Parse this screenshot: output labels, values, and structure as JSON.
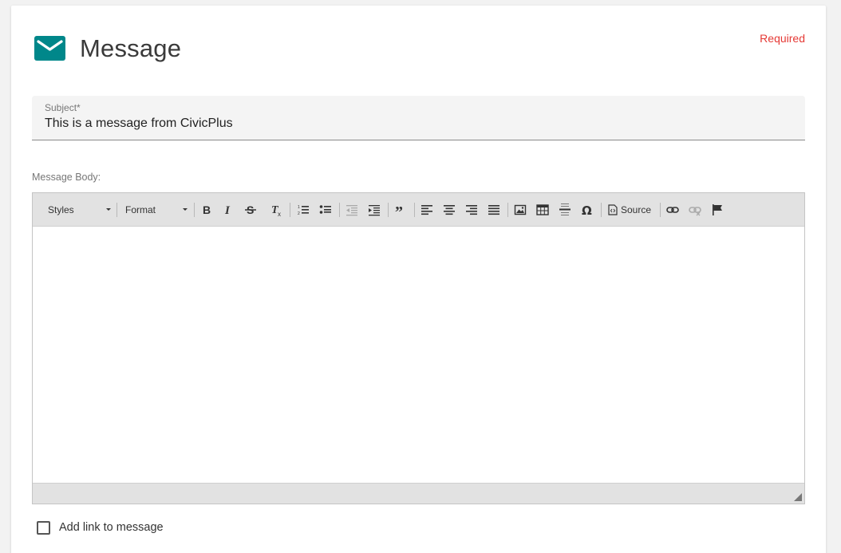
{
  "header": {
    "title": "Message",
    "icon": "mail-icon",
    "icon_color": "#00878a",
    "required_label": "Required",
    "required_color": "#e53935"
  },
  "subject": {
    "label": "Subject*",
    "value": "This is a message from CivicPlus"
  },
  "message_body": {
    "label": "Message Body:",
    "toolbar": {
      "styles_label": "Styles",
      "format_label": "Format",
      "source_label": "Source",
      "buttons": [
        "bold-icon",
        "italic-icon",
        "strikethrough-icon",
        "remove-format-icon",
        "numbered-list-icon",
        "bulleted-list-icon",
        "outdent-icon",
        "indent-icon",
        "blockquote-icon",
        "align-left-icon",
        "align-center-icon",
        "align-right-icon",
        "justify-icon",
        "image-icon",
        "table-icon",
        "horizontal-line-icon",
        "special-character-icon",
        "source-icon",
        "link-icon",
        "unlink-icon",
        "anchor-flag-icon"
      ]
    },
    "content": ""
  },
  "add_link": {
    "label": "Add link to message",
    "checked": false
  }
}
